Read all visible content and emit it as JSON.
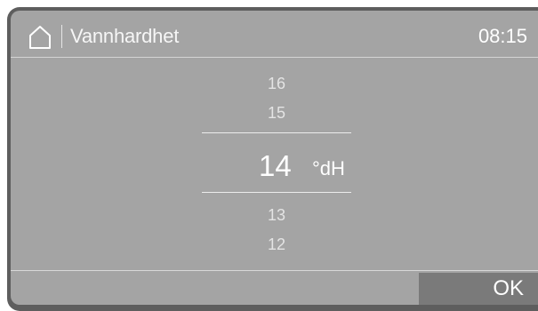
{
  "header": {
    "home_icon": "home-icon",
    "title": "Vannhardhet",
    "time": "08:15"
  },
  "picker": {
    "values_above": [
      "16",
      "15"
    ],
    "selected_value": "14",
    "unit": "°dH",
    "values_below": [
      "13",
      "12"
    ]
  },
  "footer": {
    "ok_label": "OK"
  },
  "colors": {
    "screen_background": "#a4a4a4",
    "bezel": "#5e5e5e",
    "ok_button": "#7a7a7a",
    "text": "#ffffff"
  }
}
